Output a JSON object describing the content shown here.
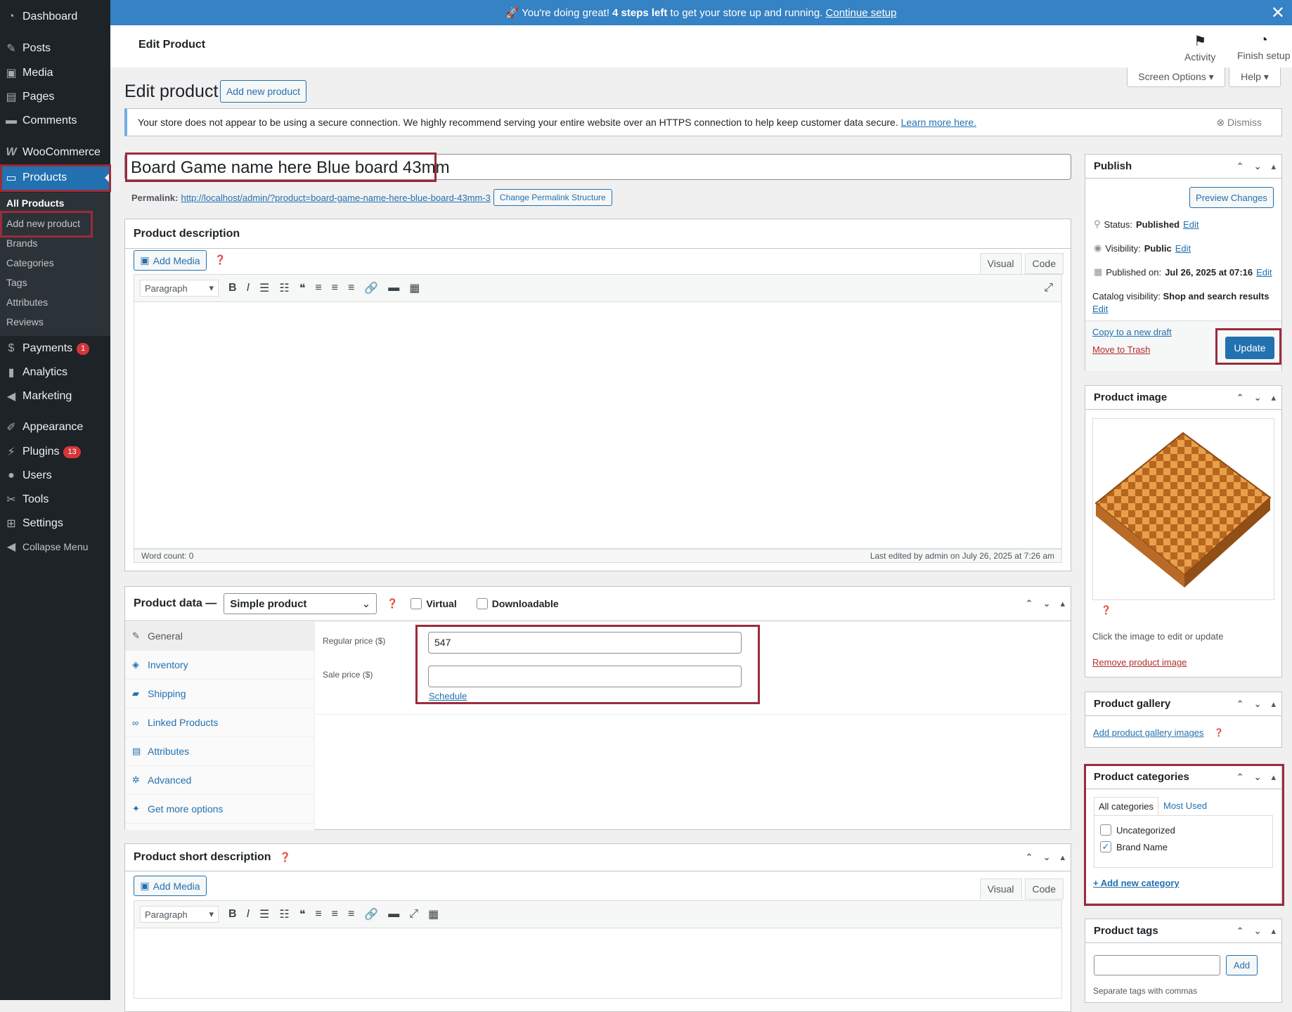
{
  "sidebar": {
    "items": [
      {
        "label": "Dashboard",
        "icon": "dashboard-icon"
      },
      {
        "label": "Posts",
        "icon": "pin-icon"
      },
      {
        "label": "Media",
        "icon": "media-icon"
      },
      {
        "label": "Pages",
        "icon": "pages-icon"
      },
      {
        "label": "Comments",
        "icon": "comment-icon"
      },
      {
        "label": "WooCommerce",
        "icon": "woo-icon"
      },
      {
        "label": "Products",
        "icon": "archive-icon"
      },
      {
        "label": "Payments",
        "icon": "dollar-icon",
        "badge": "1"
      },
      {
        "label": "Analytics",
        "icon": "bar-chart-icon"
      },
      {
        "label": "Marketing",
        "icon": "megaphone-icon"
      },
      {
        "label": "Appearance",
        "icon": "brush-icon"
      },
      {
        "label": "Plugins",
        "icon": "plug-icon",
        "badge": "13"
      },
      {
        "label": "Users",
        "icon": "user-icon"
      },
      {
        "label": "Tools",
        "icon": "wrench-icon"
      },
      {
        "label": "Settings",
        "icon": "settings-icon"
      },
      {
        "label": "Collapse Menu",
        "icon": "collapse-icon"
      }
    ],
    "submenu": [
      "All Products",
      "Add new product",
      "Brands",
      "Categories",
      "Tags",
      "Attributes",
      "Reviews"
    ]
  },
  "banner": {
    "prefix": "🚀 You're doing great! ",
    "bold": "4 steps left",
    "middle": " to get your store up and running. ",
    "link": "Continue setup",
    "close": "✕"
  },
  "header": {
    "title": "Edit Product",
    "activity": "Activity",
    "finish_setup": "Finish setup"
  },
  "screen_options": "Screen Options ▾",
  "help": "Help ▾",
  "page_title": "Edit product",
  "add_new_button": "Add new product",
  "notice": {
    "text": "Your store does not appear to be using a secure connection. We highly recommend serving your entire website over an HTTPS connection to help keep customer data secure. ",
    "link": "Learn more here.",
    "dismiss": "Dismiss"
  },
  "product_title": "Board Game name here Blue board 43mm",
  "permalink": {
    "label": "Permalink:",
    "url": "http://localhost/admin/?product=board-game-name-here-blue-board-43mm-3",
    "button": "Change Permalink Structure"
  },
  "description": {
    "title": "Product description",
    "add_media": "Add Media",
    "tab_visual": "Visual",
    "tab_code": "Code",
    "paragraph": "Paragraph",
    "word_count": "Word count: 0",
    "last_edited": "Last edited by admin on July 26, 2025 at 7:26 am"
  },
  "product_data": {
    "title": "Product data —",
    "type": "Simple product",
    "virtual": "Virtual",
    "downloadable": "Downloadable",
    "tabs": [
      "General",
      "Inventory",
      "Shipping",
      "Linked Products",
      "Attributes",
      "Advanced",
      "Get more options"
    ],
    "regular_price_label": "Regular price ($)",
    "regular_price": "547",
    "sale_price_label": "Sale price ($)",
    "sale_price": "",
    "schedule": "Schedule"
  },
  "short_description": {
    "title": "Product short description",
    "add_media": "Add Media",
    "tab_visual": "Visual",
    "tab_code": "Code",
    "paragraph": "Paragraph"
  },
  "publish": {
    "title": "Publish",
    "preview": "Preview Changes",
    "status_label": "Status:",
    "status": "Published",
    "edit": "Edit",
    "visibility_label": "Visibility:",
    "visibility": "Public",
    "published_label": "Published on:",
    "published": "Jul 26, 2025 at 07:16",
    "catalog_label": "Catalog visibility:",
    "catalog": "Shop and search results",
    "copy_draft": "Copy to a new draft",
    "trash": "Move to Trash",
    "update": "Update"
  },
  "product_image": {
    "title": "Product image",
    "hint": "Click the image to edit or update",
    "remove": "Remove product image"
  },
  "gallery": {
    "title": "Product gallery",
    "add": "Add product gallery images"
  },
  "categories": {
    "title": "Product categories",
    "tab_all": "All categories",
    "tab_most": "Most Used",
    "items": [
      {
        "label": "Uncategorized",
        "checked": false
      },
      {
        "label": "Brand Name",
        "checked": true
      }
    ],
    "add": "+ Add new category"
  },
  "tags": {
    "title": "Product tags",
    "add": "Add",
    "hint": "Separate tags with commas"
  },
  "colors": {
    "accent": "#2271b1",
    "sidebar": "#1d2327",
    "banner": "#3582c4",
    "highlight": "#9b2c3b"
  }
}
